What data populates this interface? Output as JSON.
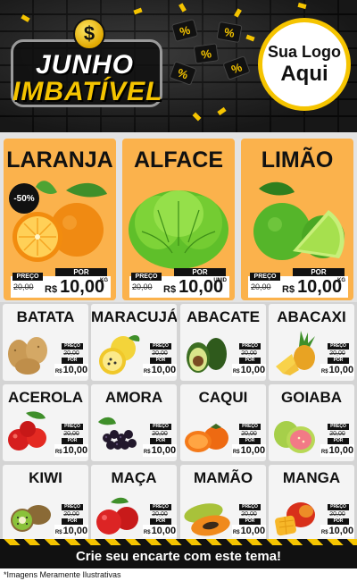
{
  "header": {
    "promo_line1": "JUNHO",
    "promo_line2": "IMBATÍVEL",
    "coin_symbol": "$",
    "percent_symbol": "%",
    "logo_line1": "Sua Logo",
    "logo_line2": "Aqui"
  },
  "labels": {
    "preco": "PREÇO",
    "por": "POR",
    "currency": "R$"
  },
  "highlights": [
    {
      "name": "LARANJA",
      "old_price": "20,00",
      "price": "10,00",
      "unit": "KG",
      "discount": "-50%"
    },
    {
      "name": "ALFACE",
      "old_price": "20,00",
      "price": "10,00",
      "unit": "UNID"
    },
    {
      "name": "LIMÃO",
      "old_price": "20,00",
      "price": "10,00",
      "unit": "KG"
    }
  ],
  "products": [
    {
      "name": "BATATA",
      "old_price": "20,00",
      "price": "10,00"
    },
    {
      "name": "MARACUJÁ",
      "old_price": "20,00",
      "price": "10,00"
    },
    {
      "name": "ABACATE",
      "old_price": "20,00",
      "price": "10,00"
    },
    {
      "name": "ABACAXI",
      "old_price": "20,00",
      "price": "10,00"
    },
    {
      "name": "ACEROLA",
      "old_price": "20,00",
      "price": "10,00"
    },
    {
      "name": "AMORA",
      "old_price": "20,00",
      "price": "10,00"
    },
    {
      "name": "CAQUI",
      "old_price": "20,00",
      "price": "10,00"
    },
    {
      "name": "GOIABA",
      "old_price": "20,00",
      "price": "10,00"
    },
    {
      "name": "KIWI",
      "old_price": "20,00",
      "price": "10,00"
    },
    {
      "name": "MAÇA",
      "old_price": "20,00",
      "price": "10,00"
    },
    {
      "name": "MAMÃO",
      "old_price": "20,00",
      "price": "10,00"
    },
    {
      "name": "MANGA",
      "old_price": "20,00",
      "price": "10,00"
    }
  ],
  "footer": {
    "cta": "Crie seu encarte com este tema!",
    "disclaimer": "*Imagens Meramente Ilustrativas"
  },
  "colors": {
    "accent_yellow": "#f5c400",
    "card_orange": "#fbb24c",
    "dark": "#111111"
  }
}
